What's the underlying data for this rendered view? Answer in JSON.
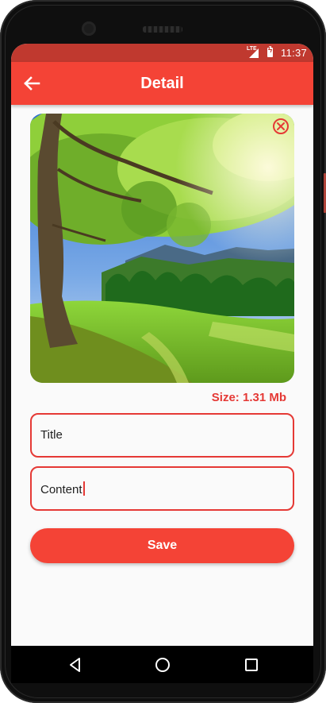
{
  "status_bar": {
    "network": "LTE",
    "time": "11:37"
  },
  "app_bar": {
    "title": "Detail",
    "back_icon": "arrow-left-icon"
  },
  "image": {
    "description_icon": "landscape-photo",
    "remove_icon": "close-circle-icon",
    "size_text": "Size: 1.31 Mb"
  },
  "form": {
    "title_value": "Title",
    "content_value": "Content",
    "save_label": "Save"
  },
  "nav_bar": {
    "back_icon": "triangle-back-icon",
    "home_icon": "circle-home-icon",
    "recents_icon": "square-recents-icon"
  },
  "colors": {
    "primary": "#f44336",
    "status_bar": "#c0392f",
    "accent": "#e53935"
  }
}
